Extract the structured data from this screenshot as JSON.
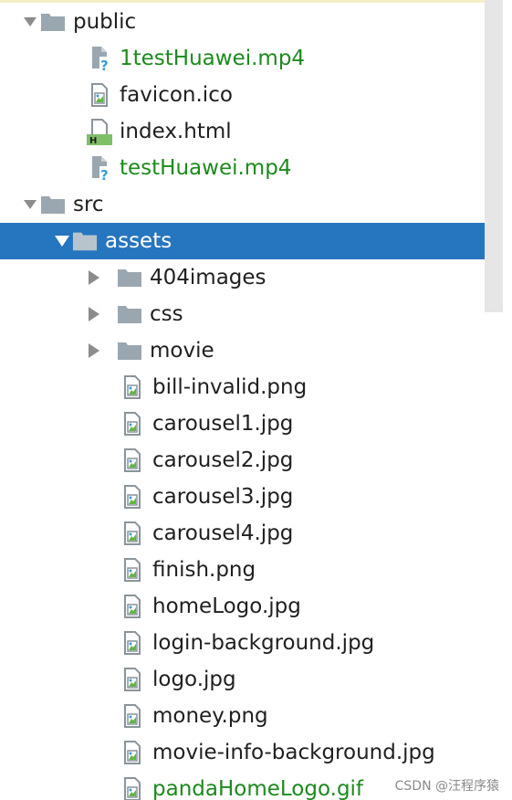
{
  "file_tree": {
    "items": [
      {
        "label": "public",
        "type": "folder",
        "expanded": true,
        "icon": "folder-icon"
      },
      {
        "label": "1testHuawei.mp4",
        "type": "file-unknown",
        "icon": "unknown-file-icon",
        "status": "unversioned",
        "color": "#1c8a1c"
      },
      {
        "label": "favicon.ico",
        "type": "image",
        "icon": "image-file-icon"
      },
      {
        "label": "index.html",
        "type": "html",
        "icon": "html-file-icon"
      },
      {
        "label": "testHuawei.mp4",
        "type": "file-unknown",
        "icon": "unknown-file-icon",
        "status": "unversioned",
        "color": "#1c8a1c"
      },
      {
        "label": "src",
        "type": "folder",
        "expanded": true,
        "icon": "folder-icon"
      },
      {
        "label": "assets",
        "type": "folder",
        "expanded": true,
        "selected": true,
        "icon": "folder-icon"
      },
      {
        "label": "404images",
        "type": "folder",
        "expanded": false,
        "icon": "folder-icon"
      },
      {
        "label": "css",
        "type": "folder",
        "expanded": false,
        "icon": "folder-icon"
      },
      {
        "label": "movie",
        "type": "folder",
        "expanded": false,
        "icon": "folder-icon"
      },
      {
        "label": "bill-invalid.png",
        "type": "image",
        "icon": "image-file-icon"
      },
      {
        "label": "carousel1.jpg",
        "type": "image",
        "icon": "image-file-icon"
      },
      {
        "label": "carousel2.jpg",
        "type": "image",
        "icon": "image-file-icon"
      },
      {
        "label": "carousel3.jpg",
        "type": "image",
        "icon": "image-file-icon"
      },
      {
        "label": "carousel4.jpg",
        "type": "image",
        "icon": "image-file-icon"
      },
      {
        "label": "finish.png",
        "type": "image",
        "icon": "image-file-icon"
      },
      {
        "label": "homeLogo.jpg",
        "type": "image",
        "icon": "image-file-icon"
      },
      {
        "label": "login-background.jpg",
        "type": "image",
        "icon": "image-file-icon"
      },
      {
        "label": "logo.jpg",
        "type": "image",
        "icon": "image-file-icon"
      },
      {
        "label": "money.png",
        "type": "image",
        "icon": "image-file-icon"
      },
      {
        "label": "movie-info-background.jpg",
        "type": "image",
        "icon": "image-file-icon"
      },
      {
        "label": "pandaHomeLogo.gif",
        "type": "image",
        "icon": "image-file-icon",
        "status": "unversioned",
        "color": "#1c8a1c"
      }
    ]
  },
  "colors": {
    "selection": "#2675bf",
    "unversioned_text": "#1c8a1c",
    "folder": "#9aa7b0",
    "arrow": "#8c8c8c"
  },
  "watermark": "CSDN @汪程序猿"
}
